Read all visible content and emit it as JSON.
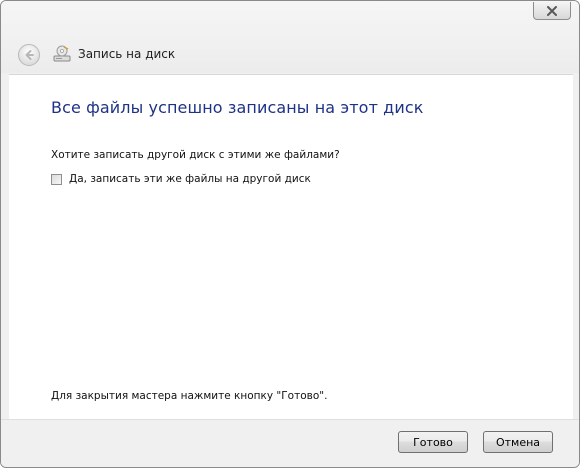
{
  "window": {
    "title": "Запись на диск",
    "close_icon": "close-icon",
    "back_icon": "back-arrow-icon",
    "title_icon": "disc-burner-icon"
  },
  "content": {
    "heading": "Все файлы успешно записаны на этот диск",
    "question": "Хотите записать другой диск с этими же файлами?",
    "checkbox": {
      "label": "Да, записать эти же файлы на другой диск",
      "checked": false
    },
    "hint": "Для закрытия мастера нажмите кнопку \"Готово\"."
  },
  "footer": {
    "done_label": "Готово",
    "cancel_label": "Отмена"
  },
  "colors": {
    "heading": "#1e3287",
    "frame": "#f0f0f0",
    "panel": "#ffffff"
  }
}
